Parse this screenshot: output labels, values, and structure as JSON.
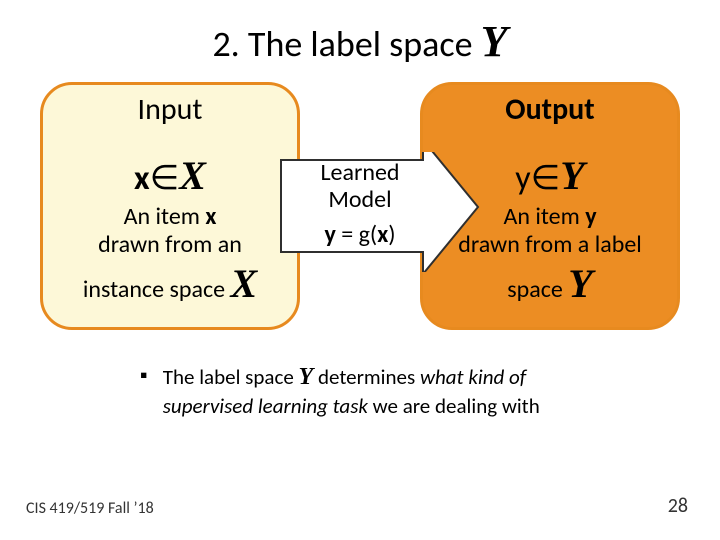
{
  "title": {
    "prefix": "2. The label space ",
    "script": "Y"
  },
  "input": {
    "heading": "Input",
    "var": "x",
    "op": "∈",
    "space": "X",
    "desc_l1_a": "An item ",
    "desc_l1_b": "x",
    "desc_l2": "drawn from an",
    "desc_l3_a": "instance space ",
    "desc_l3_b": "X"
  },
  "output": {
    "heading": "Output",
    "var": "y",
    "op": "∈",
    "space": "Y",
    "desc_l1_a": "An item ",
    "desc_l1_b": "y",
    "desc_l2": "drawn from a label",
    "desc_l3_a": "space ",
    "desc_l3_b": "Y"
  },
  "arrow": {
    "l1": "Learned",
    "l2": "Model",
    "eq_a": "y",
    "eq_b": " = g(",
    "eq_c": "x",
    "eq_d": ")"
  },
  "bullet": {
    "mark": "▪",
    "a": "The label space ",
    "y": "Y",
    "b": " determines ",
    "c": "what kind of supervised learning task",
    "d": " we are dealing with"
  },
  "footer": {
    "left": "CIS 419/519 Fall ’18",
    "right": "28"
  }
}
